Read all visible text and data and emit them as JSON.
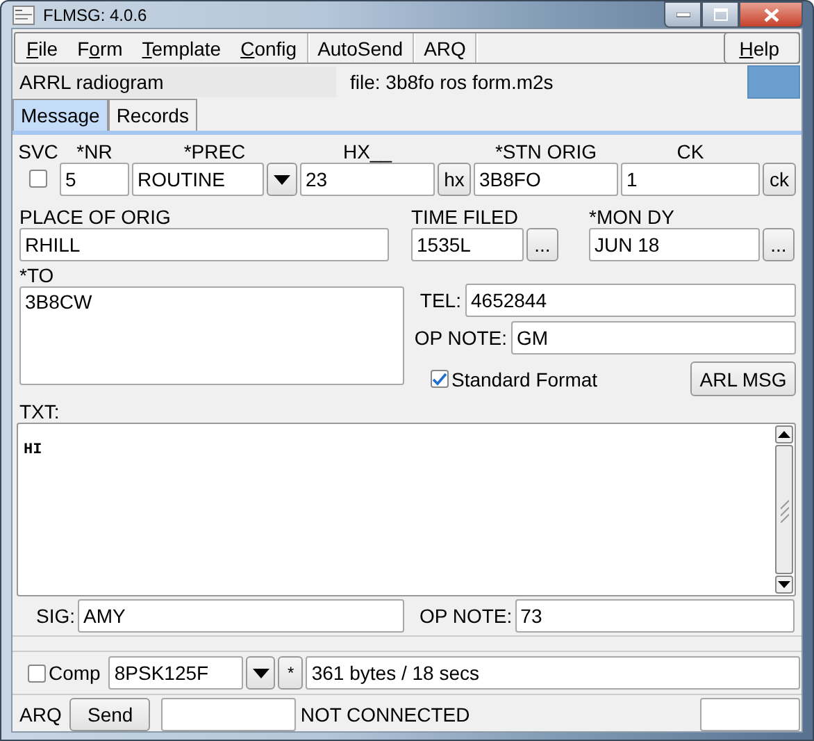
{
  "window": {
    "title": "FLMSG: 4.0.6"
  },
  "menu": [
    {
      "key": "F",
      "post": "ile",
      "separator_after": false
    },
    {
      "pre": "F",
      "key": "o",
      "post": "rm",
      "separator_after": false
    },
    {
      "key": "T",
      "post": "emplate",
      "separator_after": false
    },
    {
      "key": "C",
      "post": "onfig",
      "separator_after": true
    },
    {
      "pre": "AutoSend",
      "separator_after": true
    },
    {
      "pre": "ARQ",
      "separator_after": true
    }
  ],
  "help_menu": {
    "key": "H",
    "post": "elp"
  },
  "form_name": "ARRL radiogram",
  "file_name": "file: 3b8fo ros form.m2s",
  "tabs": [
    {
      "label": "Message",
      "selected": true
    },
    {
      "label": "Records",
      "selected": false
    }
  ],
  "svc": {
    "label": "SVC",
    "checked": false
  },
  "nr": {
    "label": "*NR",
    "value": "5"
  },
  "prec": {
    "label": "*PREC",
    "value": "ROUTINE"
  },
  "hx": {
    "label": "HX__",
    "value": "23",
    "button": "hx"
  },
  "stn_orig": {
    "label": "*STN ORIG",
    "value": "3B8FO"
  },
  "ck": {
    "label": "CK",
    "value": "1",
    "button": "ck"
  },
  "place_of_orig": {
    "label": "PLACE OF ORIG",
    "value": "RHILL"
  },
  "time_filed": {
    "label": "TIME FILED",
    "value": "1535L",
    "button": "..."
  },
  "mon_dy": {
    "label": "*MON DY",
    "value": "JUN 18",
    "button": "..."
  },
  "to": {
    "label": "*TO",
    "value": "3B8CW"
  },
  "tel": {
    "label": "TEL:",
    "value": "4652844"
  },
  "op_note": {
    "label": "OP NOTE:",
    "value": "GM"
  },
  "standard_format": {
    "label": "Standard Format",
    "checked": true
  },
  "arl_msg_button": "ARL MSG",
  "txt": {
    "label": "TXT:",
    "value": "HI"
  },
  "sig": {
    "label": "SIG:",
    "value": "AMY"
  },
  "op_note_2": {
    "label": "OP NOTE:",
    "value": "73"
  },
  "compress": {
    "label": "Comp",
    "checked": false
  },
  "mode": "8PSK125F",
  "star_button": "*",
  "transfer_status": "361 bytes / 18 secs",
  "arq": {
    "label": "ARQ",
    "send_button": "Send",
    "status": "NOT CONNECTED"
  }
}
